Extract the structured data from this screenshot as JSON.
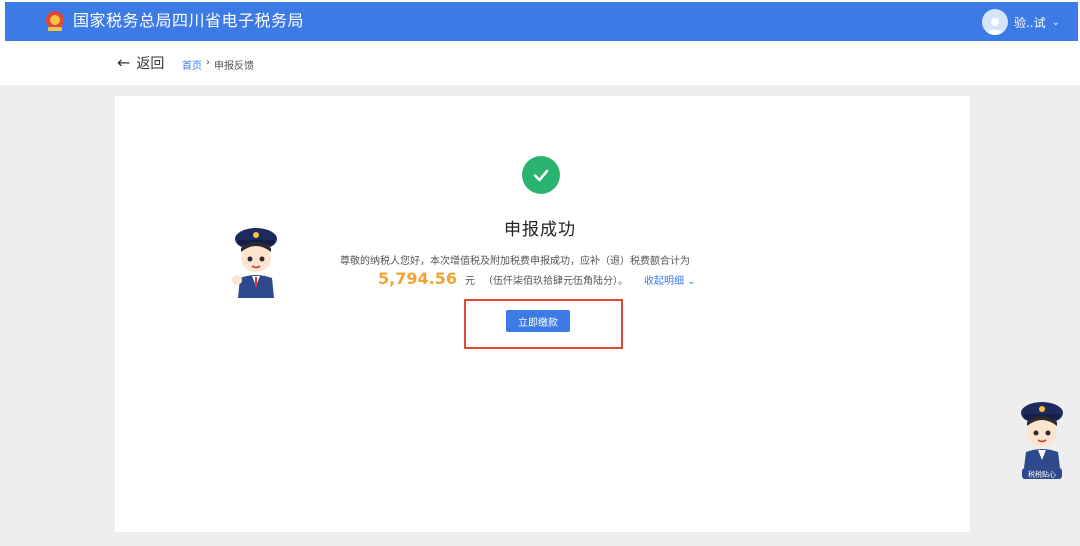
{
  "header": {
    "site_title": "国家税务总局四川省电子税务局",
    "user_name": "验..试",
    "caret": "⌄",
    "colors": {
      "bar": "#3c7ae6"
    }
  },
  "nav": {
    "back_arrow": "←",
    "back_label": "返回",
    "breadcrumb": {
      "home": "首页",
      "separator": "›",
      "current": "申报反馈"
    }
  },
  "result": {
    "icon": "check-circle-icon",
    "title": "申报成功",
    "description": "尊敬的纳税人您好，本次增值税及附加税费申报成功，应补（退）税费额合计为",
    "amount": "5,794.56",
    "unit": "元",
    "amount_in_words": "（伍仟柒佰玖拾肆元伍角陆分）。",
    "detail_link": "收起明细 ⌄",
    "pay_button": "立即缴款",
    "colors": {
      "success": "#28b36f",
      "amount": "#f0a531",
      "highlight": "#e0483d"
    }
  },
  "float_assistant": {
    "badge": "税税贴心"
  }
}
